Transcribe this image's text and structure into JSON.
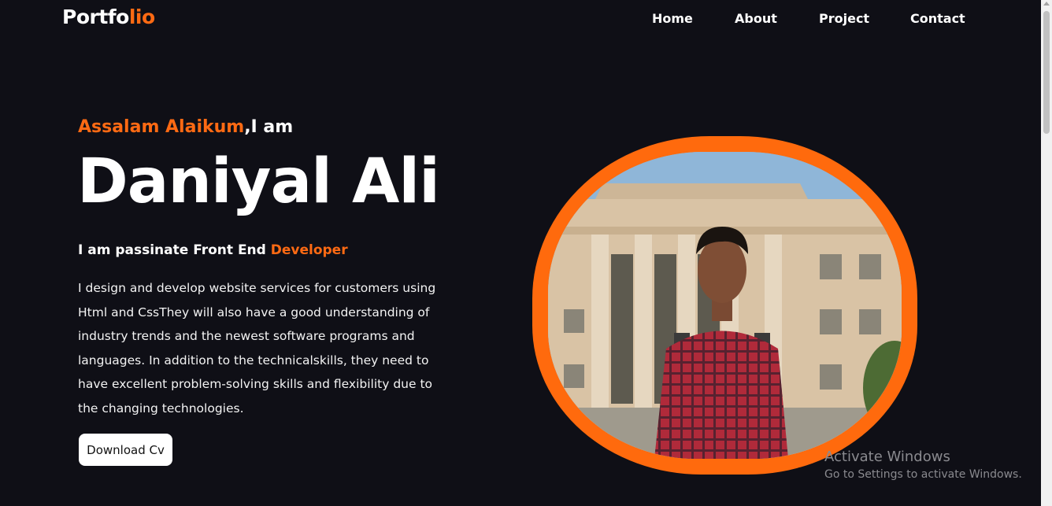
{
  "header": {
    "logo_main": "Portfo",
    "logo_accent": "lio",
    "nav": [
      {
        "label": "Home"
      },
      {
        "label": "About"
      },
      {
        "label": "Project"
      },
      {
        "label": "Contact"
      }
    ]
  },
  "hero": {
    "greeting_accent": "Assalam Alaikum",
    "greeting_rest": ",I am",
    "name": "Daniyal Ali",
    "role_main": "I am passinate Front End ",
    "role_accent": "Developer",
    "description": "I design and develop website services for customers using Html and CssThey will also have a good understanding of industry trends and the newest software programs and languages. In addition to the technicalskills, they need to have excellent problem-solving skills and flexibility due to the changing technologies.",
    "cta_label": "Download Cv"
  },
  "watermark": {
    "title": "Activate Windows",
    "subtitle": "Go to Settings to activate Windows."
  },
  "colors": {
    "background": "#0f0f16",
    "accent": "#ff6a13",
    "text": "#ffffff"
  }
}
